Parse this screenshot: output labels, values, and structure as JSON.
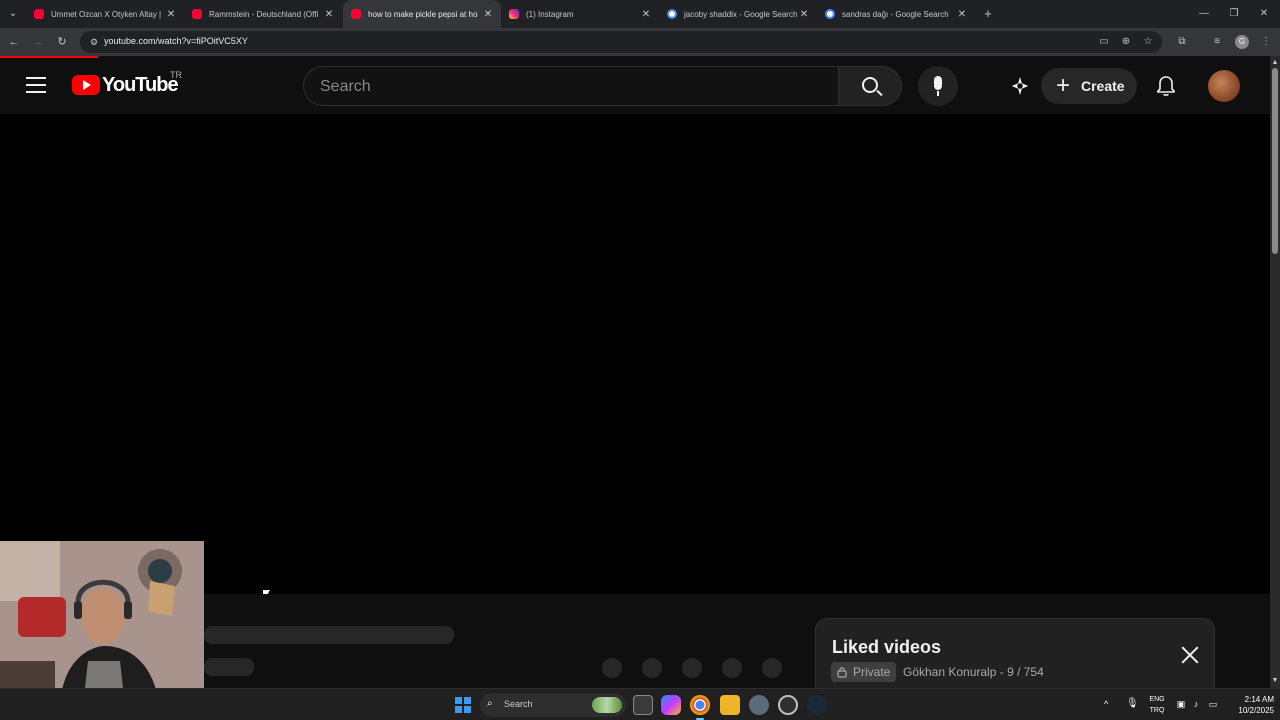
{
  "browser": {
    "tabs": [
      {
        "title": "Ummet Ozcan X Otyken Altay |",
        "favicon": "youtube",
        "active": false
      },
      {
        "title": "Rammstein - Deutschland (Offi",
        "favicon": "youtube",
        "active": false
      },
      {
        "title": "how to make pickle pepsi at ho",
        "favicon": "youtube",
        "active": true
      },
      {
        "title": "(1) Instagram",
        "favicon": "instagram",
        "active": false
      },
      {
        "title": "jacoby shaddix - Google Search",
        "favicon": "google",
        "active": false
      },
      {
        "title": "sandras dağı - Google Search",
        "favicon": "google",
        "active": false
      }
    ],
    "url": "youtube.com/watch?v=fiPOitVC5XY",
    "profile_initial": "G",
    "colors": {
      "tabstrip": "#202124",
      "toolbar": "#35363a"
    }
  },
  "youtube": {
    "logo_text": "YouTube",
    "country_code": "TR",
    "search_placeholder": "Search",
    "create_label": "Create",
    "colors": {
      "brand_red": "#ff0000",
      "background": "#0f0f0f"
    }
  },
  "playlist_panel": {
    "title": "Liked videos",
    "privacy": "Private",
    "owner_progress": "Gökhan Konuralp - 9 / 754"
  },
  "taskbar": {
    "search_label": "Search",
    "language_line1": "ENG",
    "language_line2": "TRQ",
    "time": "2:14 AM",
    "date": "10/2/2025"
  }
}
